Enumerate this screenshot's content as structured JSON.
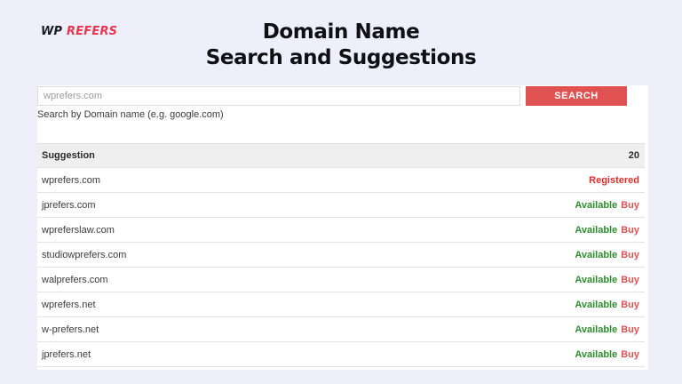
{
  "logo": {
    "part1": "WP",
    "part2": "REFERS"
  },
  "header": {
    "title_line1": "Domain Name",
    "title_line2": "Search and Suggestions"
  },
  "search": {
    "placeholder": "wprefers.com",
    "button_label": "SEARCH",
    "hint": "Search by Domain name (e.g. google.com)"
  },
  "table": {
    "header_label": "Suggestion",
    "count": "20",
    "rows": [
      {
        "domain": "wprefers.com",
        "status": "Registered",
        "buy": ""
      },
      {
        "domain": "jprefers.com",
        "status": "Available",
        "buy": "Buy"
      },
      {
        "domain": "wpreferslaw.com",
        "status": "Available",
        "buy": "Buy"
      },
      {
        "domain": "studiowprefers.com",
        "status": "Available",
        "buy": "Buy"
      },
      {
        "domain": "walprefers.com",
        "status": "Available",
        "buy": "Buy"
      },
      {
        "domain": "wprefers.net",
        "status": "Available",
        "buy": "Buy"
      },
      {
        "domain": "w-prefers.net",
        "status": "Available",
        "buy": "Buy"
      },
      {
        "domain": "jprefers.net",
        "status": "Available",
        "buy": "Buy"
      }
    ]
  },
  "colors": {
    "brand": "#e8354f",
    "search_button": "#e05252",
    "registered": "#dd2c2c",
    "available": "#2e8b2e",
    "background": "#efeffb"
  }
}
